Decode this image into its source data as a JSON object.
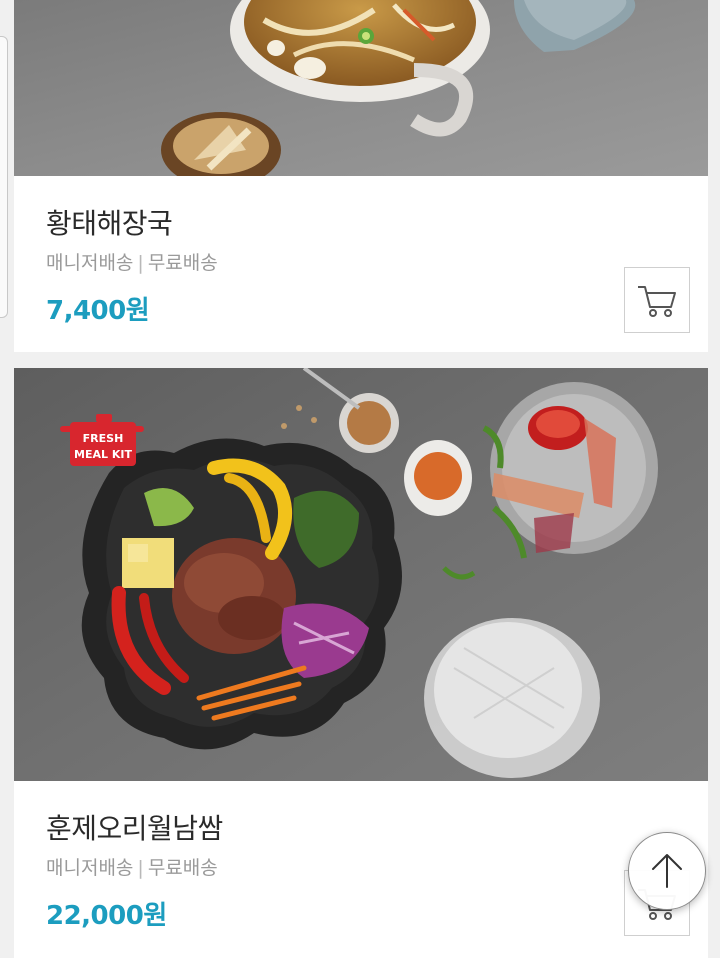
{
  "products": [
    {
      "name": "황태해장국",
      "shipping": [
        "매니저배송",
        "무료배송"
      ],
      "separator": "|",
      "price": "7,400원",
      "cart_icon": "cart-icon"
    },
    {
      "name": "훈제오리월남쌈",
      "shipping": [
        "매니저배송",
        "무료배송"
      ],
      "separator": "|",
      "price": "22,000원",
      "cart_icon": "cart-icon",
      "badge": [
        "FRESH",
        "MEAL KIT"
      ]
    }
  ],
  "scroll_top_icon": "arrow-up-icon",
  "colors": {
    "price": "#1c9dbf",
    "name": "#2a2a2a",
    "shipping": "#9a9a9a",
    "background": "#f0f0f0",
    "badge": "#d8262e"
  }
}
